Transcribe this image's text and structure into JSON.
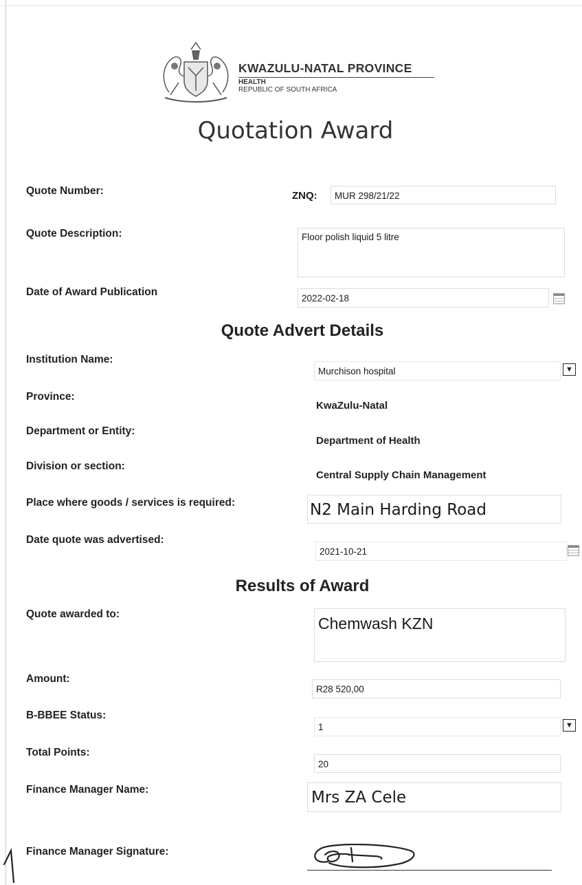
{
  "header": {
    "org_name": "KWAZULU-NATAL PROVINCE",
    "dept": "HEALTH",
    "country": "REPUBLIC OF SOUTH AFRICA"
  },
  "title": "Quotation Award",
  "quote": {
    "number_label": "Quote Number:",
    "znq_prefix": "ZNQ:",
    "number_value": "MUR 298/21/22",
    "description_label": "Quote Description:",
    "description_value": "Floor polish liquid 5 litre",
    "date_label": "Date of Award Publication",
    "date_value": "2022-02-18"
  },
  "advert": {
    "section_title": "Quote Advert Details",
    "institution_label": "Institution Name:",
    "institution_value": "Murchison hospital",
    "province_label": "Province:",
    "province_value": "KwaZulu-Natal",
    "department_label": "Department or Entity:",
    "department_value": "Department of Health",
    "division_label": "Division or section:",
    "division_value": "Central Supply Chain Management",
    "place_label": "Place where goods /  services is required:",
    "place_value": "N2 Main Harding Road",
    "advertised_label": "Date quote was advertised:",
    "advertised_value": "2021-10-21"
  },
  "results": {
    "section_title": "Results of Award",
    "awarded_label": "Quote awarded to:",
    "awarded_value": "Chemwash KZN",
    "amount_label": "Amount:",
    "amount_value": "R28 520,00",
    "bbbee_label": "B-BBEE Status:",
    "bbbee_value": "1",
    "points_label": "Total Points:",
    "points_value": "20",
    "fm_name_label": "Finance Manager Name:",
    "fm_name_value": "Mrs ZA Cele",
    "fm_sig_label": "Finance Manager Signature:"
  },
  "icons": {
    "crest": "coat-of-arms-icon",
    "calendar": "calendar-icon",
    "dropdown": "chevron-down-icon"
  }
}
